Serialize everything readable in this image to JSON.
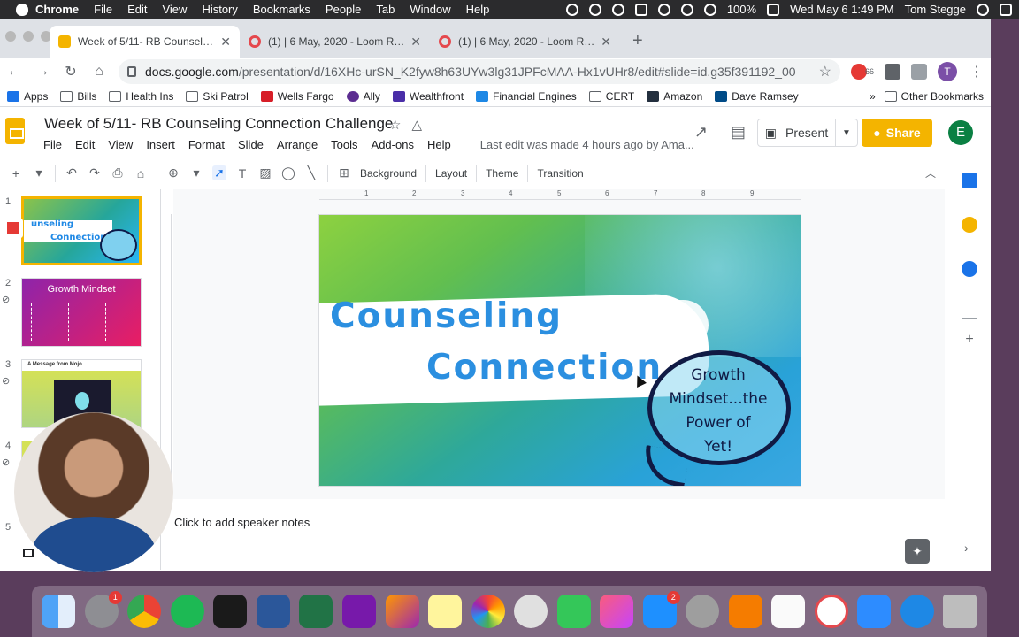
{
  "menubar": {
    "app": "Chrome",
    "items": [
      "File",
      "Edit",
      "View",
      "History",
      "Bookmarks",
      "People",
      "Tab",
      "Window",
      "Help"
    ],
    "battery": "100%",
    "datetime": "Wed May 6  1:49 PM",
    "user": "Tom Stegge"
  },
  "tabs": [
    {
      "title": "Week of 5/11- RB Counseling C",
      "active": true
    },
    {
      "title": "(1) | 6 May, 2020 - Loom Reco",
      "active": false
    },
    {
      "title": "(1) | 6 May, 2020 - Loom Reco",
      "active": false
    }
  ],
  "address": {
    "host": "docs.google.com",
    "path": "/presentation/d/16XHc-urSN_K2fyw8h63UYw3lg31JPFcMAA-Hx1vUHr8/edit#slide=id.g35f391192_00",
    "ext_badge": "66",
    "profile_initial": "T"
  },
  "bookmarks": {
    "items": [
      "Apps",
      "Bills",
      "Health Ins",
      "Ski Patrol",
      "Wells Fargo",
      "Ally",
      "Wealthfront",
      "Financial Engines",
      "CERT",
      "Amazon",
      "Dave Ramsey"
    ],
    "overflow": "»",
    "other": "Other Bookmarks"
  },
  "doc": {
    "title": "Week of 5/11- RB Counseling Connection Challenge",
    "menus": [
      "File",
      "Edit",
      "View",
      "Insert",
      "Format",
      "Slide",
      "Arrange",
      "Tools",
      "Add-ons",
      "Help"
    ],
    "last_edit": "Last edit was made 4 hours ago by Ama...",
    "present_label": "Present",
    "share_label": "Share",
    "user_initial": "E"
  },
  "edit_toolbar": {
    "background": "Background",
    "layout": "Layout",
    "theme": "Theme",
    "transition": "Transition"
  },
  "ruler": [
    "1",
    "2",
    "3",
    "4",
    "5",
    "6",
    "7",
    "8",
    "9"
  ],
  "filmstrip": {
    "numbers": [
      "1",
      "2",
      "3",
      "4",
      "5"
    ],
    "slide1_line1": "unseling",
    "slide1_line2": "Connection",
    "slide2_title": "Growth Mindset",
    "slide3_title": "A Message from Mojo"
  },
  "slide": {
    "line1": "Counseling",
    "line2": "Connection",
    "bubble": [
      "Growth",
      "Mindset...the",
      "Power of",
      "Yet!"
    ]
  },
  "notes": {
    "placeholder": "Click to add speaker notes"
  },
  "colors": {
    "accent": "#f4b400",
    "slide_text": "#2b8fe0",
    "bubble_outline": "#101a44"
  },
  "dock": [
    "finder",
    "system-preferences",
    "chrome",
    "spotify",
    "loom",
    "word",
    "excel",
    "onenote",
    "claquette",
    "notes",
    "photos",
    "screenflow",
    "facetime",
    "music",
    "app-store",
    "launchpad",
    "fusion-360",
    "acrobat",
    "loom-desktop",
    "zoom",
    "safari",
    "trash"
  ],
  "dock_badges": {
    "system-preferences": "1",
    "app-store": "2"
  }
}
